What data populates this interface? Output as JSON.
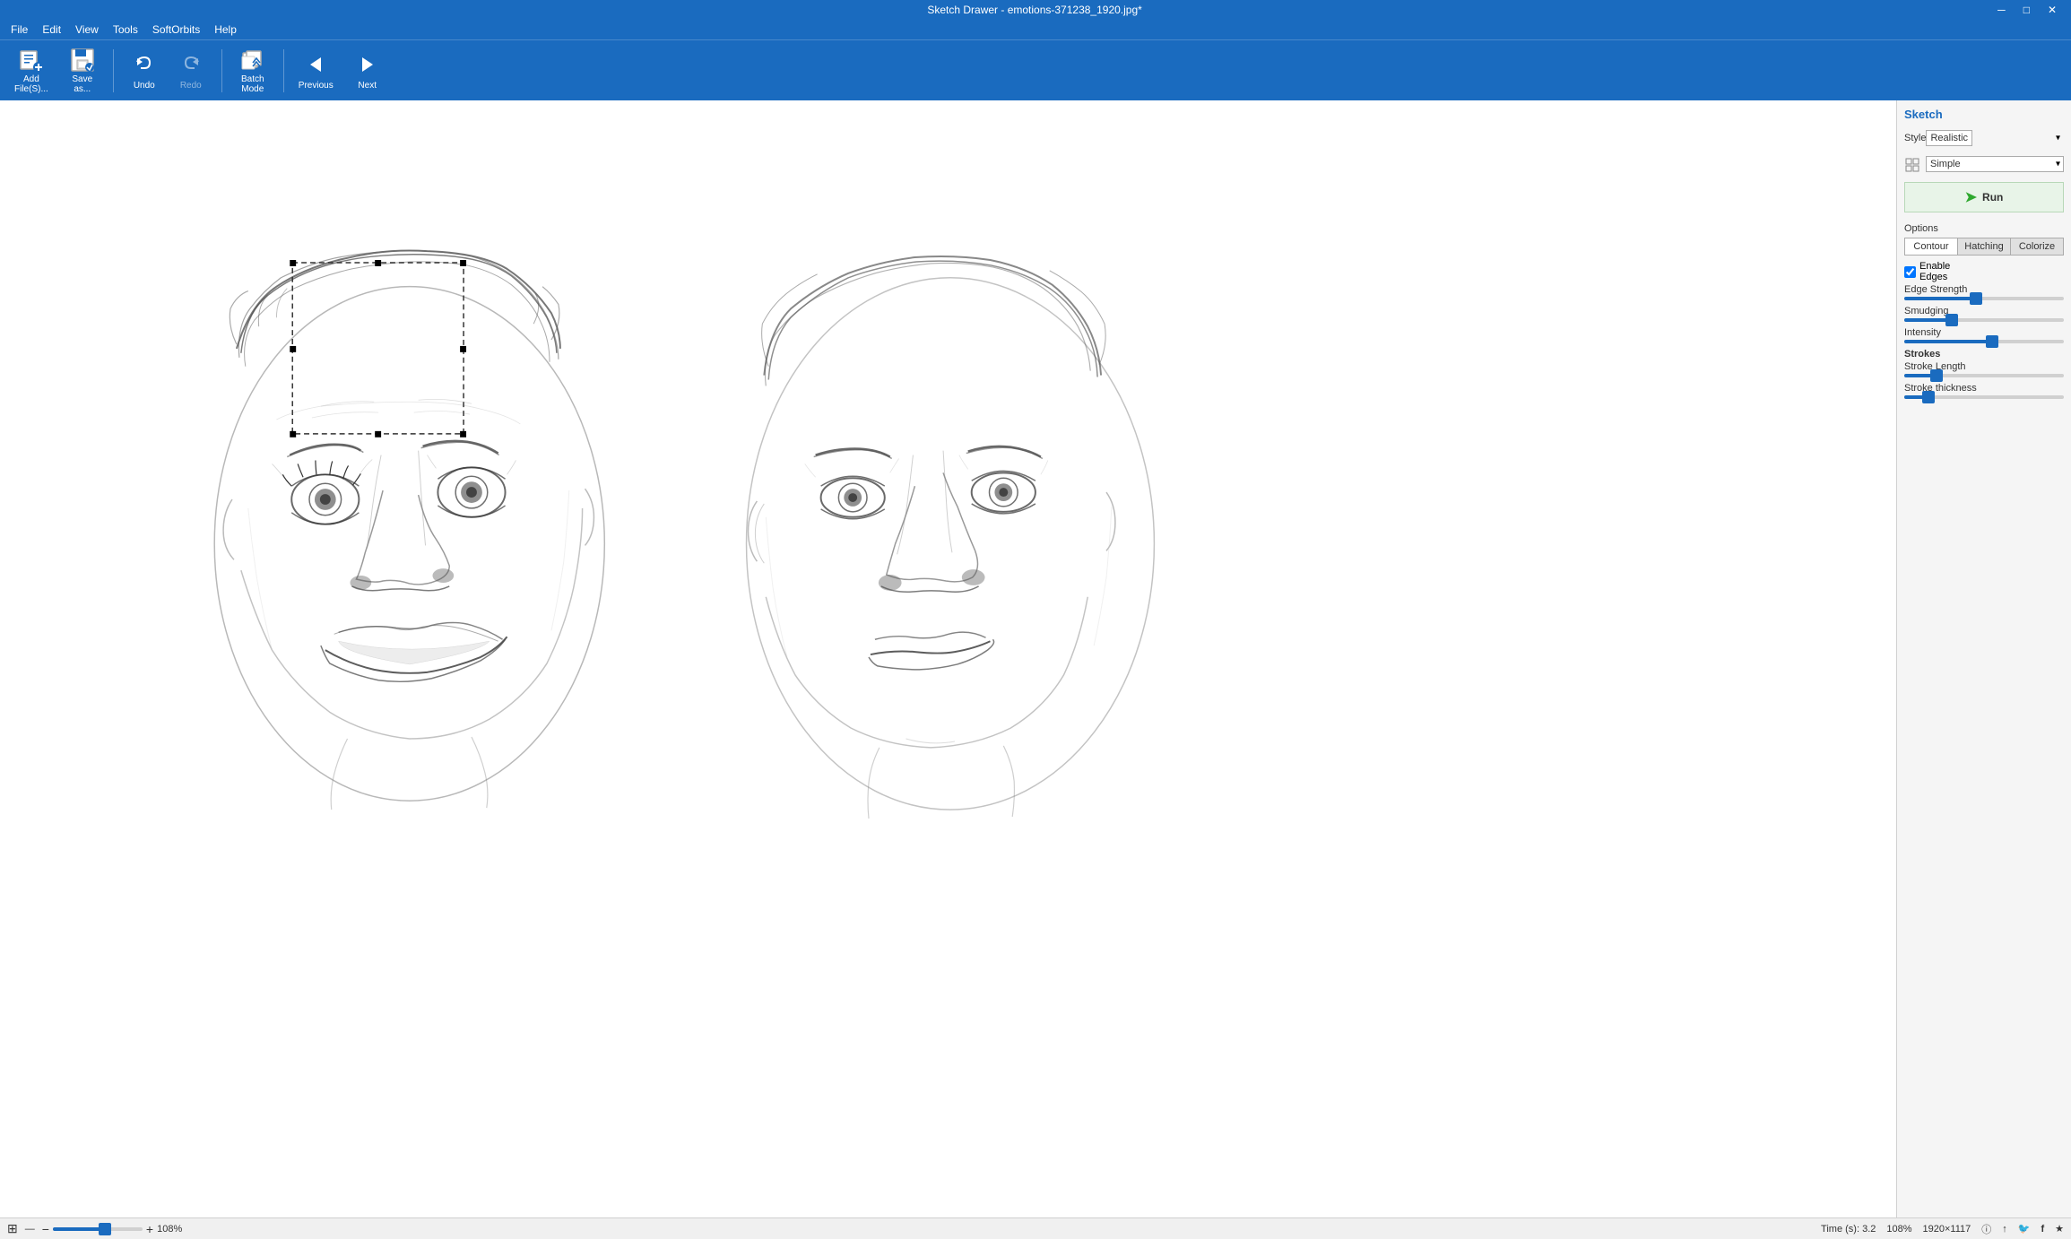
{
  "titleBar": {
    "title": "Sketch Drawer - emotions-371238_1920.jpg*",
    "minBtn": "─",
    "maxBtn": "□",
    "closeBtn": "✕"
  },
  "menuBar": {
    "items": [
      "File",
      "Edit",
      "View",
      "Tools",
      "SoftOrbits",
      "Help"
    ]
  },
  "toolbar": {
    "addFiles": "Add\nFile(S)...",
    "saveAs": "Save\nas...",
    "undo": "Undo",
    "redo": "",
    "batchMode": "Batch\nMode",
    "previous": "Previous",
    "next": "Next"
  },
  "rightPanel": {
    "title": "Sketch",
    "style": {
      "label": "Style",
      "value": "Realistic"
    },
    "presets": {
      "label": "Presets",
      "value": "Simple"
    },
    "runBtn": "Run",
    "options": {
      "label": "Options",
      "tabs": [
        "Contour",
        "Hatching",
        "Colorize"
      ],
      "enableEdges": "Enable\nEdges",
      "edgeStrength": {
        "label": "Edge Strength",
        "value": 45
      },
      "smudging": {
        "label": "Smudging",
        "value": 30
      },
      "intensity": {
        "label": "Intensity",
        "value": 55
      },
      "strokes": "Strokes",
      "strokeLength": {
        "label": "Stroke Length",
        "value": 20
      },
      "strokeThickness": {
        "label": "Stroke thickness",
        "value": 15
      }
    }
  },
  "statusBar": {
    "viewIcon": "⊞",
    "separator": "—",
    "zoomOut": "−",
    "zoomIn": "+",
    "zoomValue": "108%",
    "timeLabel": "Time (s): 3.2",
    "zoomRight": "108%",
    "resolution": "1920×1117",
    "infoIcon": "ⓘ",
    "shareIcon": "↑",
    "twitterIcon": "🐦",
    "facebookIcon": "f",
    "starIcon": "★"
  }
}
